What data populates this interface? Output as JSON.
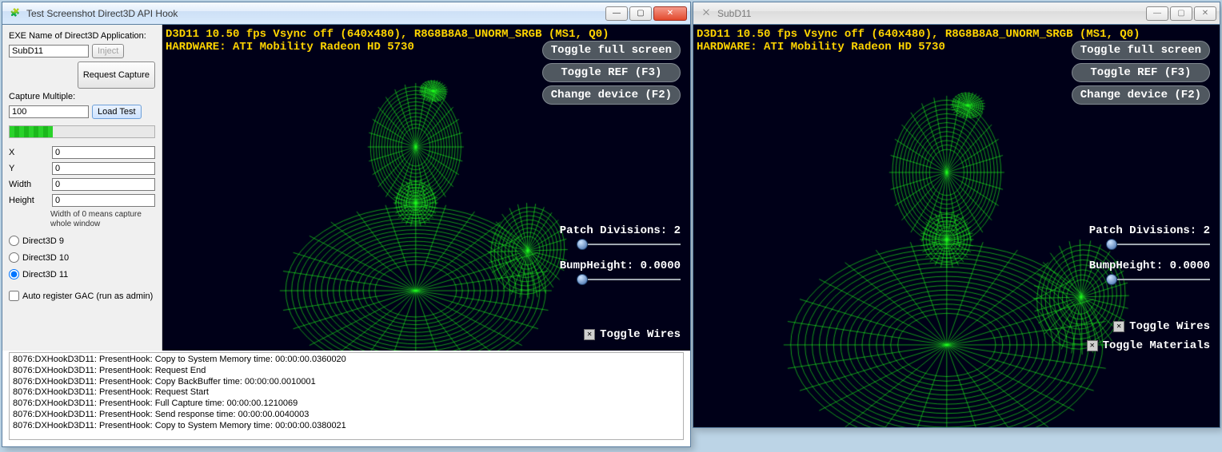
{
  "main_window": {
    "title": "Test Screenshot Direct3D API Hook",
    "sidebar": {
      "exe_label": "EXE Name of Direct3D Application:",
      "exe_value": "SubD11",
      "inject_label": "Inject",
      "request_capture_label": "Request Capture",
      "capture_multiple_label": "Capture Multiple:",
      "capture_multiple_value": "100",
      "load_test_label": "Load Test",
      "x_label": "X",
      "x_value": "0",
      "y_label": "Y",
      "y_value": "0",
      "width_label": "Width",
      "width_value": "0",
      "height_label": "Height",
      "height_value": "0",
      "note": "Width of 0 means capture whole window",
      "radio_d3d9": "Direct3D 9",
      "radio_d3d10": "Direct3D 10",
      "radio_d3d11": "Direct3D 11",
      "auto_register": "Auto register GAC (run as admin)"
    },
    "log_lines": [
      "8076:DXHookD3D11: PresentHook: Copy to System Memory time: 00:00:00.0360020",
      "8076:DXHookD3D11: PresentHook: Request End",
      "8076:DXHookD3D11: PresentHook: Copy BackBuffer time: 00:00:00.0010001",
      "8076:DXHookD3D11: PresentHook: Request Start",
      "8076:DXHookD3D11: PresentHook: Full Capture time: 00:00:00.1210069",
      "8076:DXHookD3D11: PresentHook: Send response time: 00:00:00.0040003",
      "8076:DXHookD3D11: PresentHook: Copy to System Memory time: 00:00:00.0380021"
    ]
  },
  "d3d_overlay": {
    "line1": "D3D11 10.50 fps Vsync off (640x480), R8G8B8A8_UNORM_SRGB (MS1, Q0)",
    "line2": "HARDWARE: ATI Mobility Radeon HD 5730",
    "btn_fullscreen": "Toggle full screen",
    "btn_ref": "Toggle REF (F3)",
    "btn_device": "Change device (F2)",
    "patch_label": "Patch Divisions: 2",
    "bump_label": "BumpHeight: 0.0000",
    "toggle_wires": "Toggle Wires",
    "toggle_materials": "Toggle Materials"
  },
  "sub_window": {
    "title": "SubD11"
  }
}
